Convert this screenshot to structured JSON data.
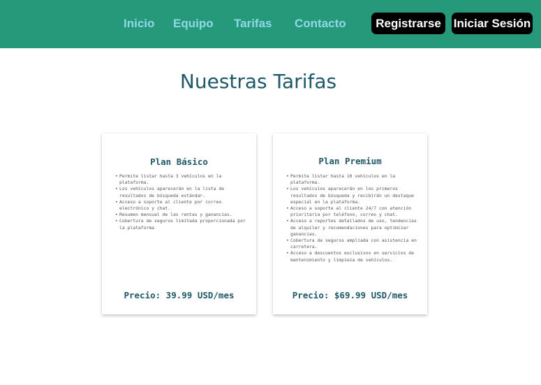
{
  "nav": {
    "links": [
      "Inicio",
      "Equipo",
      "Tarifas",
      "Contacto"
    ],
    "register_label": "Registrarse",
    "login_label": "Iniciar Sesión"
  },
  "colors": {
    "navbar": "#26997a",
    "nav_link": "#8fd8e8",
    "title": "#1f5868",
    "button_bg": "#000000"
  },
  "page_title": "Nuestras Tarifas",
  "plans": [
    {
      "name": "Plan Básico",
      "features": [
        "Permite listar hasta 3 vehículos en la plataforma.",
        "Los vehículos aparecerán en la lista de resultados de búsqueda estándar.",
        "Acceso a soporte al cliente por correo electrónico y chat.",
        "Resumen mensual de las rentas y ganancias.",
        "Cobertura de seguros limitada proporcionada por la plataforma"
      ],
      "price": "Precio: 39.99 USD/mes"
    },
    {
      "name": "Plan Premium",
      "features": [
        "Permite listar hasta 10 vehículos en la plataforma.",
        "Los vehículos aparecerán en los primeros resultados de búsqueda y recibirán un destaque especial en la plataforma.",
        "Acceso a soporte al cliente 24/7 con atención prioritaria por teléfono, correo y chat.",
        "Acceso a reportes detallados de uso, tendencias de alquiler y recomendaciones para optimizar ganancias.",
        "Cobertura de seguros ampliada con asistencia en carretera.",
        "Acceso a descuentos exclusivos en servicios de mantenimiento y limpieza de vehículos."
      ],
      "price": "Precio: $69.99 USD/mes"
    }
  ]
}
